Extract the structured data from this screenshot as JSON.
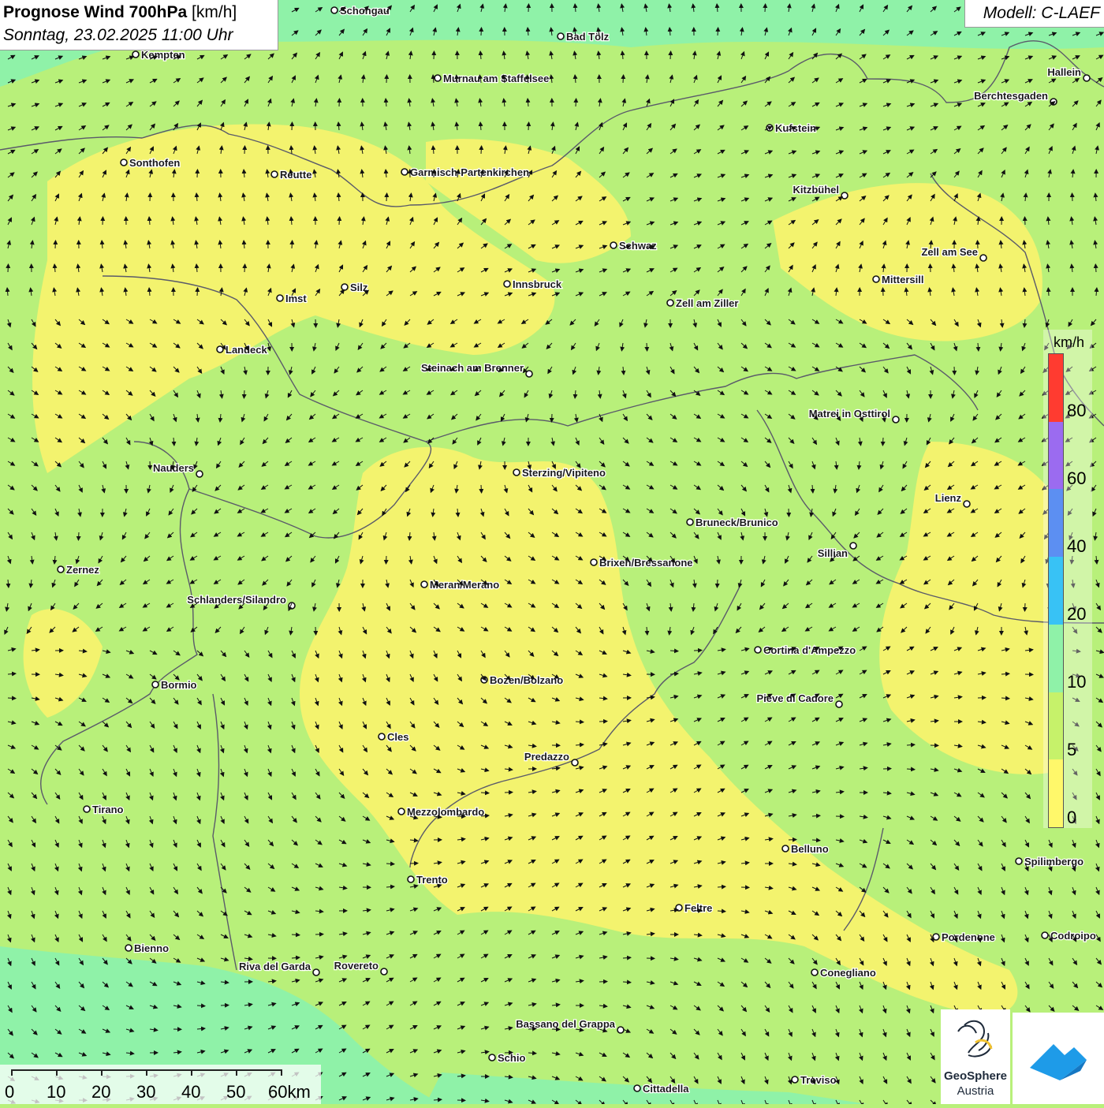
{
  "header": {
    "title_bold": "Prognose Wind 700hPa",
    "title_unit": "[km/h]",
    "datetime": "Sonntag, 23.02.2025 11:00 Uhr",
    "model": "Modell: C-LAEF"
  },
  "legend": {
    "unit": "km/h",
    "labels": [
      "80",
      "60",
      "40",
      "20",
      "10",
      "5",
      "0"
    ],
    "colors": [
      "#ff3b30",
      "#9b6bf0",
      "#5c8ff2",
      "#38c2f5",
      "#8ff2a8",
      "#c6f26a",
      "#fff86a"
    ]
  },
  "scale_bar": {
    "labels": [
      "0",
      "10",
      "20",
      "30",
      "40",
      "50",
      "60km"
    ]
  },
  "colors": {
    "yellow": "#f3f36e",
    "light_green": "#b8f07a",
    "mint": "#8ff2a0",
    "border": "#5a5a6a"
  },
  "cities": [
    {
      "name": "Schongau"
    },
    {
      "name": "Bad Tölz"
    },
    {
      "name": "Kempten"
    },
    {
      "name": "Murnau am Staffelsee"
    },
    {
      "name": "Hallein"
    },
    {
      "name": "Berchtesgaden"
    },
    {
      "name": "Kufstein"
    },
    {
      "name": "Sonthofen"
    },
    {
      "name": "Reutte"
    },
    {
      "name": "Garmisch-Partenkirchen"
    },
    {
      "name": "Kitzbühel"
    },
    {
      "name": "Schwaz"
    },
    {
      "name": "Zell am See"
    },
    {
      "name": "Mittersill"
    },
    {
      "name": "Innsbruck"
    },
    {
      "name": "Silz"
    },
    {
      "name": "Imst"
    },
    {
      "name": "Zell am Ziller"
    },
    {
      "name": "Landeck"
    },
    {
      "name": "Steinach am Brenner"
    },
    {
      "name": "Matrei in Osttirol"
    },
    {
      "name": "Nauders"
    },
    {
      "name": "Sterzing/Vipiteno"
    },
    {
      "name": "Lienz"
    },
    {
      "name": "Bruneck/Brunico"
    },
    {
      "name": "Sillian"
    },
    {
      "name": "Brixen/Bressanone"
    },
    {
      "name": "Zernez"
    },
    {
      "name": "Meran/Merano"
    },
    {
      "name": "Schlanders/Silandro"
    },
    {
      "name": "Cortina d'Ampezzo"
    },
    {
      "name": "Bozen/Bolzano"
    },
    {
      "name": "Bormio"
    },
    {
      "name": "Pieve di Cadore"
    },
    {
      "name": "Cles"
    },
    {
      "name": "Predazzo"
    },
    {
      "name": "Tirano"
    },
    {
      "name": "Mezzolombardo"
    },
    {
      "name": "Belluno"
    },
    {
      "name": "Spilimbergo"
    },
    {
      "name": "Trento"
    },
    {
      "name": "Feltre"
    },
    {
      "name": "Pordenone"
    },
    {
      "name": "Codroipo"
    },
    {
      "name": "Bienno"
    },
    {
      "name": "Riva del Garda"
    },
    {
      "name": "Rovereto"
    },
    {
      "name": "Conegliano"
    },
    {
      "name": "Bassano del Grappa"
    },
    {
      "name": "Schio"
    },
    {
      "name": "Treviso"
    },
    {
      "name": "Cittadella"
    }
  ],
  "logos": {
    "geo_line1": "GeoSphere",
    "geo_line2": "Austria"
  }
}
